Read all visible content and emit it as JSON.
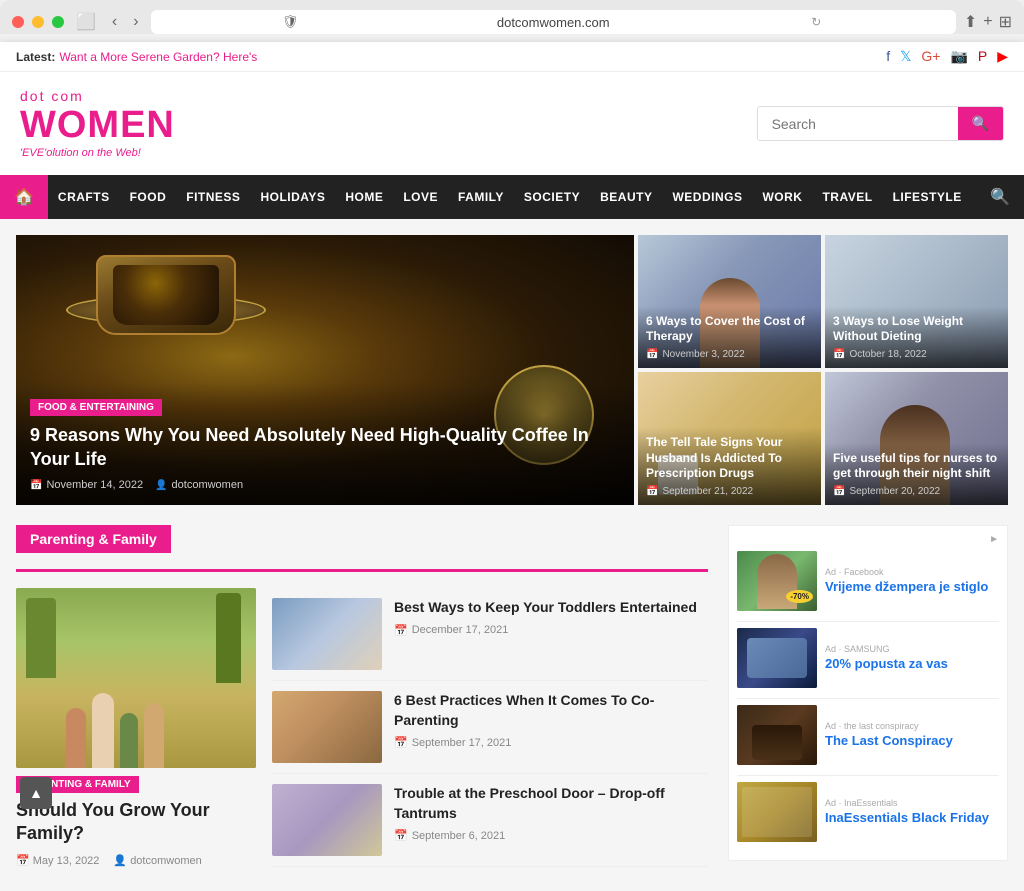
{
  "browser": {
    "url": "dotcomwomen.com",
    "reload_title": "Reload"
  },
  "topbar": {
    "latest_label": "Latest:",
    "latest_link": "Want a More Serene Garden? Here's",
    "social": [
      {
        "name": "facebook",
        "icon": "f",
        "label": "Facebook"
      },
      {
        "name": "twitter",
        "icon": "t",
        "label": "Twitter"
      },
      {
        "name": "google-plus",
        "icon": "G+",
        "label": "Google Plus"
      },
      {
        "name": "instagram",
        "icon": "ig",
        "label": "Instagram"
      },
      {
        "name": "pinterest",
        "icon": "P",
        "label": "Pinterest"
      },
      {
        "name": "youtube",
        "icon": "yt",
        "label": "YouTube"
      }
    ]
  },
  "logo": {
    "dot_com": "dot com",
    "women": "WOMEN",
    "tagline": "'EVE'olution on the Web!"
  },
  "search": {
    "placeholder": "Search",
    "button_label": "🔍"
  },
  "nav": {
    "home_icon": "🏠",
    "items": [
      {
        "label": "CRAFTS",
        "href": "#"
      },
      {
        "label": "FOOD",
        "href": "#"
      },
      {
        "label": "FITNESS",
        "href": "#"
      },
      {
        "label": "HOLIDAYS",
        "href": "#"
      },
      {
        "label": "HOME",
        "href": "#"
      },
      {
        "label": "LOVE",
        "href": "#"
      },
      {
        "label": "FAMILY",
        "href": "#"
      },
      {
        "label": "SOCIETY",
        "href": "#"
      },
      {
        "label": "BEAUTY",
        "href": "#"
      },
      {
        "label": "WEDDINGS",
        "href": "#"
      },
      {
        "label": "WORK",
        "href": "#"
      },
      {
        "label": "TRAVEL",
        "href": "#"
      },
      {
        "label": "LIFESTYLE",
        "href": "#"
      }
    ]
  },
  "hero": {
    "category": "Food & Entertaining",
    "title": "9 Reasons Why You Need Absolutely Need High-Quality Coffee In Your Life",
    "date": "November 14, 2022",
    "author": "dotcomwomen"
  },
  "side_articles": [
    {
      "title": "6 Ways to Cover the Cost of Therapy",
      "date": "November 3, 2022",
      "bg": "therapy"
    },
    {
      "title": "3 Ways to Lose Weight Without Dieting",
      "date": "October 18, 2022",
      "bg": "weight"
    },
    {
      "title": "The Tell Tale Signs Your Husband Is Addicted To Prescription Drugs",
      "date": "September 21, 2022",
      "bg": "prescription"
    },
    {
      "title": "Five useful tips for nurses to get through their night shift",
      "date": "September 20, 2022",
      "bg": "nurses"
    }
  ],
  "parenting_section": {
    "heading": "Parenting & Family",
    "main_article": {
      "category": "Parenting & Family",
      "title": "Should You Grow Your Family?",
      "date": "May 13, 2022",
      "author": "dotcomwomen"
    },
    "articles": [
      {
        "title": "Best Ways to Keep Your Toddlers Entertained",
        "date": "December 17, 2021"
      },
      {
        "title": "6 Best Practices When It Comes To Co-Parenting",
        "date": "September 17, 2021"
      },
      {
        "title": "Trouble at the Preschool Door – Drop-off Tantrums",
        "date": "September 6, 2021"
      }
    ]
  },
  "sidebar": {
    "ad_label": "►",
    "ads": [
      {
        "title": "Vrijeme džempera je stiglo",
        "brand": "Facebook",
        "tag": "Ad"
      },
      {
        "title": "20% popusta za vas",
        "brand": "SAMSUNG",
        "tag": "Ad"
      },
      {
        "title": "The Last Conspiracy",
        "brand": "the last conspiracy",
        "tag": "Ad"
      },
      {
        "title": "InaEssentials Black Friday",
        "brand": "InaEssentials",
        "tag": "Ad"
      }
    ]
  },
  "scroll_top": "▲"
}
